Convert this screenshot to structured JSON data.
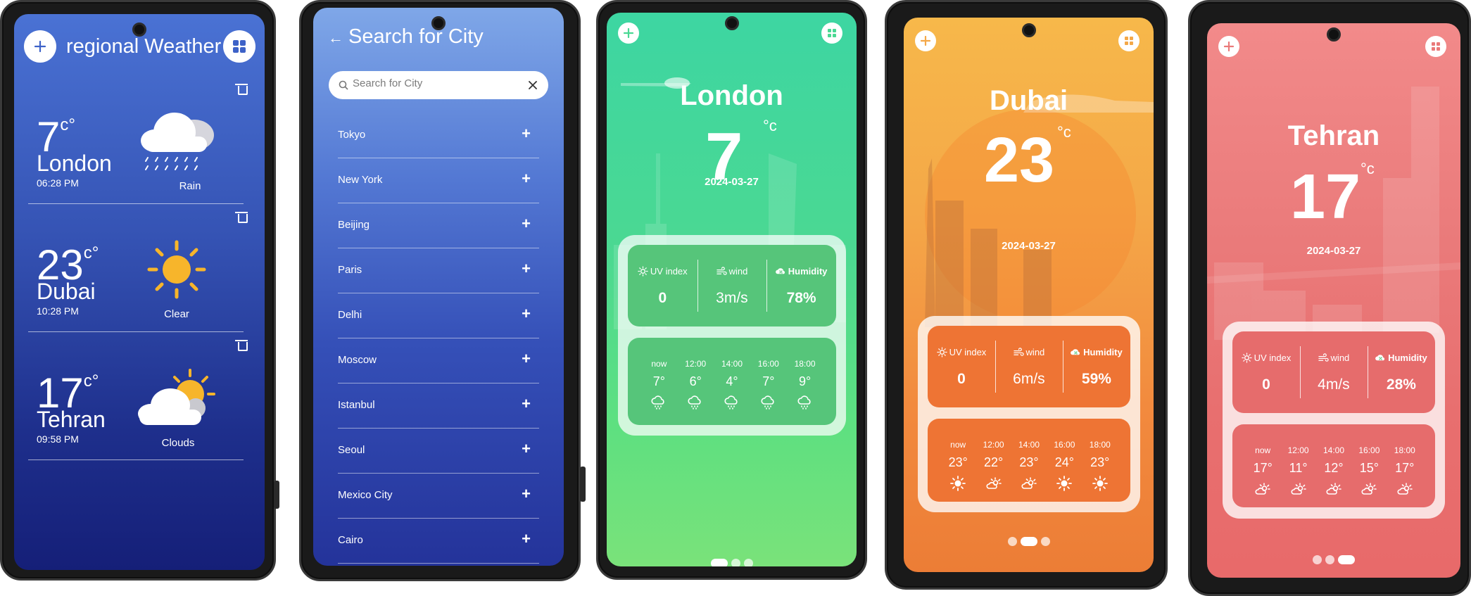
{
  "colors": {
    "blue_bg": "#3553b4",
    "green_card": "#56c57a",
    "orange_card": "#ee7434",
    "red_card": "#e66c6c",
    "sun_yellow": "#f7b52b"
  },
  "list_screen": {
    "title": "regional Weather",
    "add_icon": "plus-icon",
    "grid_icon": "grid-icon",
    "cities": [
      {
        "temp": "7",
        "unit": "c",
        "deg": "°",
        "name": "London",
        "time": "06:28 PM",
        "condition": "Rain",
        "icon": "rain-cloud-icon"
      },
      {
        "temp": "23",
        "unit": "c",
        "deg": "°",
        "name": "Dubai",
        "time": "10:28 PM",
        "condition": "Clear",
        "icon": "sun-icon"
      },
      {
        "temp": "17",
        "unit": "c",
        "deg": "°",
        "name": "Tehran",
        "time": "09:58 PM",
        "condition": "Clouds",
        "icon": "cloud-sun-icon"
      }
    ]
  },
  "search_screen": {
    "title": "Search for City",
    "placeholder": "Search for City",
    "cities": [
      "Tokyo",
      "New York",
      "Beijing",
      "Paris",
      "Delhi",
      "Moscow",
      "Istanbul",
      "Seoul",
      "Mexico City",
      "Cairo"
    ]
  },
  "detail_screens": [
    {
      "city": "London",
      "temp": "7",
      "unit": "°c",
      "date": "2024-03-27",
      "stats": [
        {
          "label": "UV index",
          "value": "0"
        },
        {
          "label": "wind",
          "value": "3m/s"
        },
        {
          "label": "Humidity",
          "value": "78%"
        }
      ],
      "hours": [
        {
          "t": "now",
          "v": "7°",
          "icon": "rain-cloud-icon"
        },
        {
          "t": "12:00",
          "v": "6°",
          "icon": "rain-cloud-icon"
        },
        {
          "t": "14:00",
          "v": "4°",
          "icon": "rain-cloud-icon"
        },
        {
          "t": "16:00",
          "v": "7°",
          "icon": "rain-cloud-icon"
        },
        {
          "t": "18:00",
          "v": "9°",
          "icon": "rain-cloud-icon"
        }
      ],
      "active_page": 0
    },
    {
      "city": "Dubai",
      "temp": "23",
      "unit": "°c",
      "date": "2024-03-27",
      "stats": [
        {
          "label": "UV index",
          "value": "0"
        },
        {
          "label": "wind",
          "value": "6m/s"
        },
        {
          "label": "Humidity",
          "value": "59%"
        }
      ],
      "hours": [
        {
          "t": "now",
          "v": "23°",
          "icon": "sun-icon"
        },
        {
          "t": "12:00",
          "v": "22°",
          "icon": "cloud-sun-icon"
        },
        {
          "t": "14:00",
          "v": "23°",
          "icon": "cloud-sun-icon"
        },
        {
          "t": "16:00",
          "v": "24°",
          "icon": "sun-icon"
        },
        {
          "t": "18:00",
          "v": "23°",
          "icon": "sun-icon"
        }
      ],
      "active_page": 1
    },
    {
      "city": "Tehran",
      "temp": "17",
      "unit": "°c",
      "date": "2024-03-27",
      "stats": [
        {
          "label": "UV index",
          "value": "0"
        },
        {
          "label": "wind",
          "value": "4m/s"
        },
        {
          "label": "Humidity",
          "value": "28%"
        }
      ],
      "hours": [
        {
          "t": "now",
          "v": "17°",
          "icon": "cloud-sun-icon"
        },
        {
          "t": "12:00",
          "v": "11°",
          "icon": "cloud-sun-icon"
        },
        {
          "t": "14:00",
          "v": "12°",
          "icon": "cloud-sun-icon"
        },
        {
          "t": "16:00",
          "v": "15°",
          "icon": "cloud-sun-icon"
        },
        {
          "t": "18:00",
          "v": "17°",
          "icon": "cloud-sun-icon"
        }
      ],
      "active_page": 2
    }
  ]
}
